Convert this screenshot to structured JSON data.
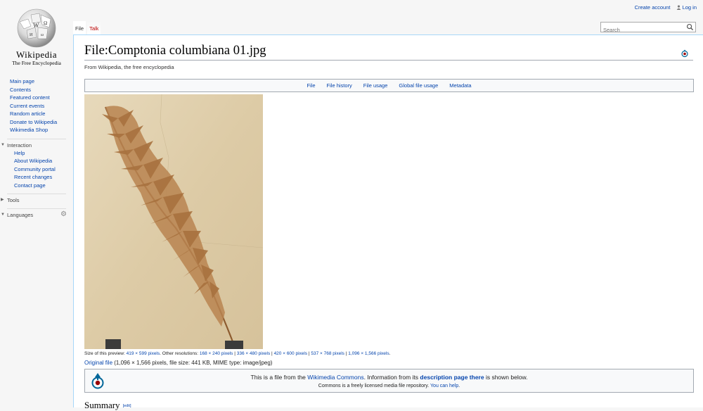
{
  "site": {
    "wordmark": "Wikipedia",
    "tagline": "The Free Encyclopedia"
  },
  "sidebar": {
    "navigation": [
      "Main page",
      "Contents",
      "Featured content",
      "Current events",
      "Random article",
      "Donate to Wikipedia",
      "Wikimedia Shop"
    ],
    "interaction": {
      "label": "Interaction",
      "items": [
        "Help",
        "About Wikipedia",
        "Community portal",
        "Recent changes",
        "Contact page"
      ]
    },
    "tools": {
      "label": "Tools"
    },
    "languages": {
      "label": "Languages"
    }
  },
  "personal": {
    "create_account": "Create account",
    "log_in": "Log in"
  },
  "tabs": {
    "file": "File",
    "talk": "Talk"
  },
  "search": {
    "placeholder": "Search"
  },
  "page": {
    "title": "File:Comptonia columbiana 01.jpg",
    "subtitle": "From Wikipedia, the free encyclopedia"
  },
  "filetoc": [
    "File",
    "File history",
    "File usage",
    "Global file usage",
    "Metadata"
  ],
  "preview": {
    "size_prefix": "Size of this preview: ",
    "size_link": "419 × 599 pixels",
    "other_prefix": ". Other resolutions: ",
    "resolutions": [
      "168 × 240 pixels",
      "336 × 480 pixels",
      "420 × 600 pixels",
      "537 × 768 pixels",
      "1,096 × 1,566 pixels"
    ],
    "suffix": "."
  },
  "original": {
    "link": "Original file",
    "details": " (1,096 × 1,566 pixels, file size: 441 KB, MIME type: image/jpeg)"
  },
  "commons": {
    "t1_a": "This is a file from the ",
    "t1_link": "Wikimedia Commons",
    "t1_b": ". Information from its ",
    "t1_bold": "description page there",
    "t1_c": " is shown below.",
    "t2_a": "Commons is a freely licensed media file repository. ",
    "t2_link": "You can help",
    "t2_b": "."
  },
  "summary": {
    "heading": "Summary",
    "edit": "[edit]"
  },
  "colors": {
    "link": "#0645ad",
    "new_link": "#ba0000",
    "border": "#a7d7f9"
  }
}
